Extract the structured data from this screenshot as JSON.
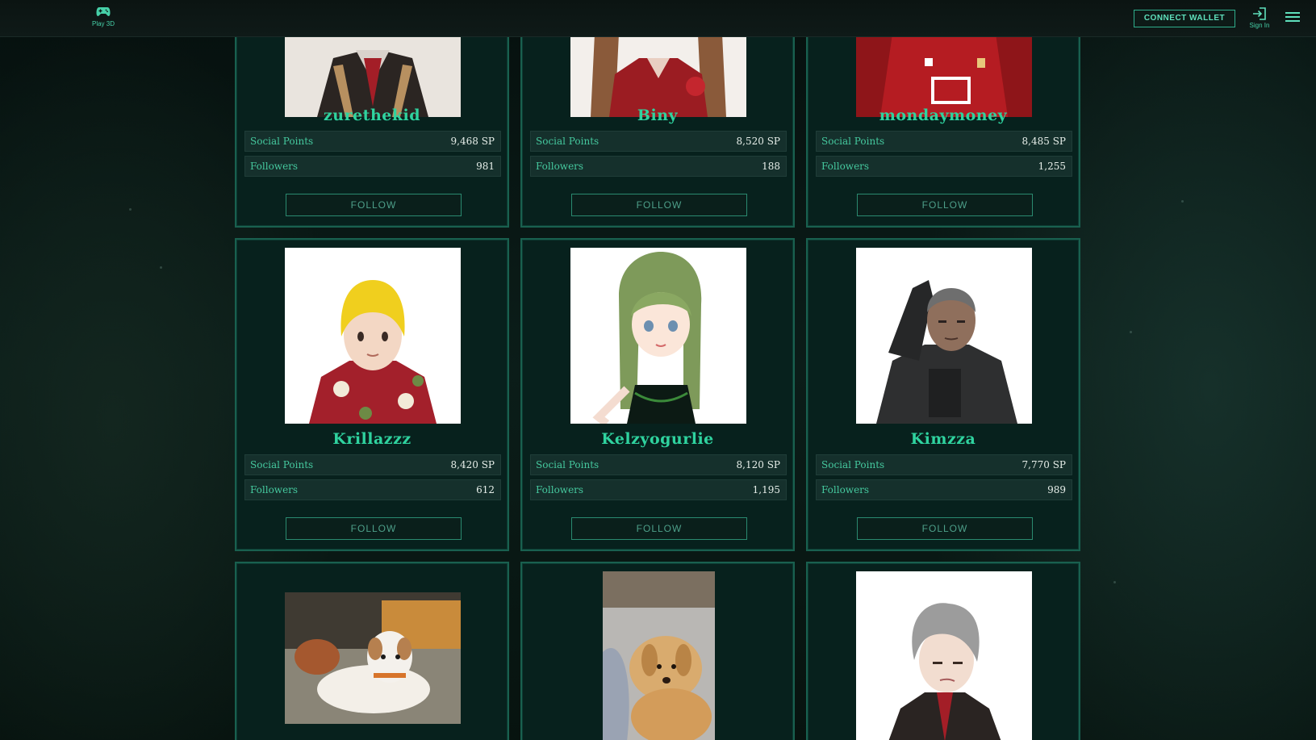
{
  "header": {
    "play_label": "Play 3D",
    "connect_wallet_label": "CONNECT WALLET",
    "sign_in_label": "Sign In"
  },
  "labels": {
    "social_points": "Social Points",
    "followers": "Followers",
    "follow": "FOLLOW"
  },
  "colors": {
    "accent": "#2fd39f",
    "card_border": "#19604f",
    "background": "#0b1d19"
  },
  "profiles": [
    {
      "name": "zurethekid",
      "social_points": "9,468 SP",
      "followers": "981",
      "avatar": "anime-avatar-dark-jacket-red-tie"
    },
    {
      "name": "Biny",
      "social_points": "8,520 SP",
      "followers": "188",
      "avatar": "anime-avatar-red-dress"
    },
    {
      "name": "mondaymoney",
      "social_points": "8,485 SP",
      "followers": "1,255",
      "avatar": "red-football-jersey"
    },
    {
      "name": "Krillazzz",
      "social_points": "8,420 SP",
      "followers": "612",
      "avatar": "anime-avatar-blonde-hawaiian-shirt"
    },
    {
      "name": "Kelzyogurlie",
      "social_points": "8,120 SP",
      "followers": "1,195",
      "avatar": "anime-avatar-green-hair"
    },
    {
      "name": "Kimzza",
      "social_points": "7,770 SP",
      "followers": "989",
      "avatar": "anime-avatar-saluting-soldier"
    },
    {
      "name": "",
      "avatar": "photo-white-dog"
    },
    {
      "name": "",
      "avatar": "photo-golden-puppy"
    },
    {
      "name": "",
      "avatar": "anime-avatar-grey-hair-red-tie"
    }
  ]
}
